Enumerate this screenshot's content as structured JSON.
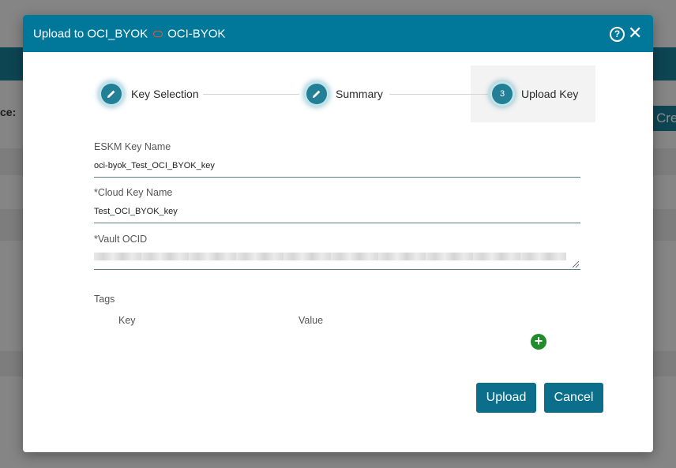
{
  "background": {
    "label": "ce:",
    "button_label": "Cre"
  },
  "modal": {
    "title_prefix": "Upload to OCI_BYOK",
    "title_suffix": "OCI-BYOK",
    "help_symbol": "?",
    "close_symbol": "✕"
  },
  "stepper": {
    "steps": [
      {
        "label": "Key Selection",
        "icon": "pencil-icon",
        "state": "completed"
      },
      {
        "label": "Summary",
        "icon": "pencil-icon",
        "state": "completed"
      },
      {
        "label": "Upload Key",
        "number": "3",
        "state": "active"
      }
    ]
  },
  "form": {
    "eskm_key_name": {
      "label": "ESKM Key Name",
      "value": "oci-byok_Test_OCI_BYOK_key"
    },
    "cloud_key_name": {
      "label": "*Cloud Key Name",
      "value": "Test_OCI_BYOK_key"
    },
    "vault_ocid": {
      "label": "*Vault OCID",
      "value_redacted": true
    },
    "tags": {
      "label": "Tags",
      "columns": [
        "Key",
        "Value"
      ],
      "add_icon": "plus-circle-icon"
    }
  },
  "buttons": {
    "upload": "Upload",
    "cancel": "Cancel"
  },
  "colors": {
    "header": "#01789a",
    "step_circle": "#227f96",
    "button": "#0b6f8c",
    "add_icon": "#218c2c"
  }
}
